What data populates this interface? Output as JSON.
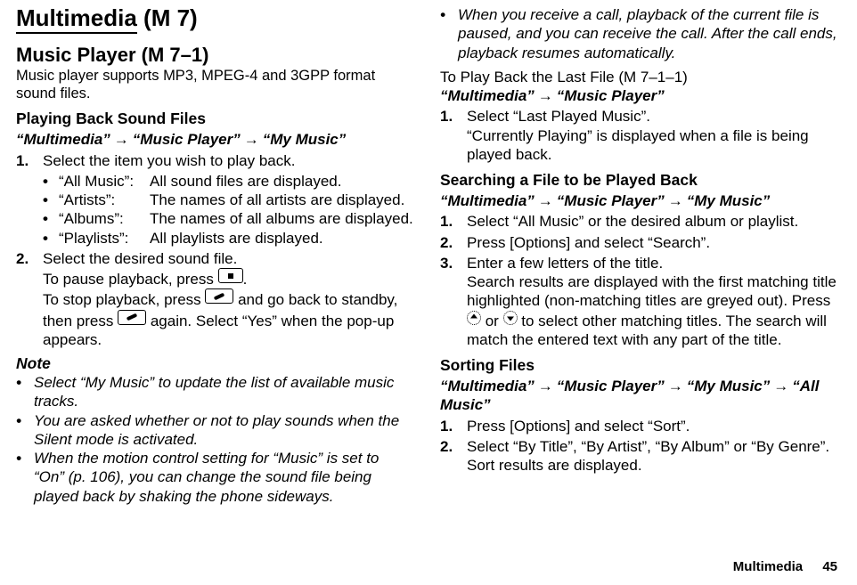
{
  "title": {
    "main": "Multimedia",
    "num": "(M 7)"
  },
  "section": {
    "main": "Music Player",
    "num": "(M 7–1)"
  },
  "intro": "Music player supports MP3, MPEG-4 and 3GPP format sound files.",
  "left": {
    "sub1": "Playing Back Sound Files",
    "path1": {
      "a": "“Multimedia”",
      "b": "“Music Player”",
      "c": "“My Music”"
    },
    "step1": {
      "num": "1.",
      "text": "Select the item you wish to play back."
    },
    "defs": [
      {
        "term": "“All Music”:",
        "desc": "All sound files are displayed."
      },
      {
        "term": "“Artists”:",
        "desc": "The names of all artists are displayed."
      },
      {
        "term": "“Albums”:",
        "desc": "The names of all albums are displayed."
      },
      {
        "term": "“Playlists”:",
        "desc": "All playlists are displayed."
      }
    ],
    "step2": {
      "num": "2.",
      "line1": "Select the desired sound file.",
      "line2a": "To pause playback, press ",
      "line2b": ".",
      "line3a": "To stop playback, press ",
      "line3b": " and go back to standby, then press ",
      "line3c": " again. Select “Yes” when the pop-up appears."
    },
    "noteHead": "Note",
    "notes": [
      "Select “My Music” to update the list of available music tracks.",
      "You are asked whether or not to play sounds when the Silent mode is activated.",
      "When the motion control setting for “Music” is set to “On” (p. 106), you can change the sound file being played back by shaking the phone sideways."
    ]
  },
  "right": {
    "contNote": "When you receive a call, playback of the current file is paused, and you can receive the call. After the call ends, playback resumes automatically.",
    "playLastHead": "To Play Back the Last File",
    "playLastNum": "(M 7–1–1)",
    "path2": {
      "a": "“Multimedia”",
      "b": "“Music Player”"
    },
    "step_pl_1": {
      "num": "1.",
      "line1": "Select “Last Played Music”.",
      "line2": "“Currently Playing” is displayed when a file is being played back."
    },
    "searchHead": "Searching a File to be Played Back",
    "path3": {
      "a": "“Multimedia”",
      "b": "“Music Player”",
      "c": "“My Music”"
    },
    "search_steps": [
      {
        "num": "1.",
        "text": "Select “All Music” or the desired album or playlist."
      },
      {
        "num": "2.",
        "text": "Press [Options] and select “Search”."
      }
    ],
    "search_step3": {
      "num": "3.",
      "line1": "Enter a few letters of the title.",
      "line2a": "Search results are displayed with the first matching title highlighted (non-matching titles are greyed out). Press ",
      "line2b": " or ",
      "line2c": " to select other matching titles. The search will match the entered text with any part of the title."
    },
    "sortHead": "Sorting Files",
    "path4": {
      "a": "“Multimedia”",
      "b": "“Music Player”",
      "c": "“My Music”",
      "d": "“All Music”"
    },
    "sort_steps": [
      {
        "num": "1.",
        "text": "Press [Options] and select “Sort”."
      }
    ],
    "sort_step2": {
      "num": "2.",
      "line1": "Select “By Title”, “By Artist”, “By Album” or “By Genre”.",
      "line2": "Sort results are displayed."
    }
  },
  "footer": {
    "label": "Multimedia",
    "page": "45"
  }
}
